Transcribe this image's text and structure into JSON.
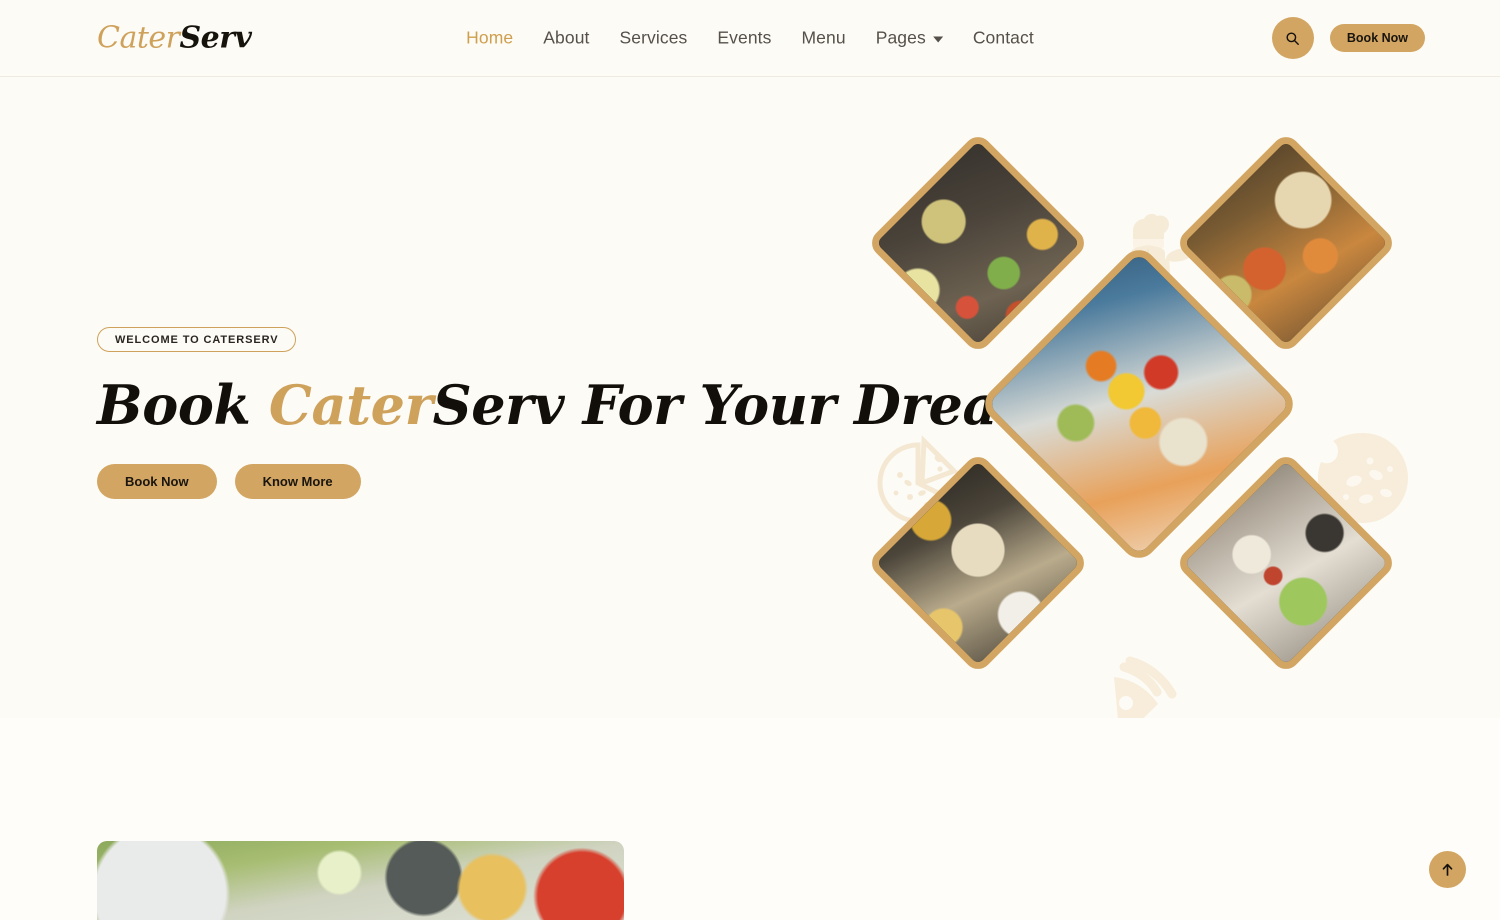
{
  "brand": {
    "logo_part_one": "Cater",
    "logo_part_two": "Serv"
  },
  "header": {
    "nav": [
      {
        "label": "Home",
        "active": true,
        "has_dropdown": false
      },
      {
        "label": "About",
        "active": false,
        "has_dropdown": false
      },
      {
        "label": "Services",
        "active": false,
        "has_dropdown": false
      },
      {
        "label": "Events",
        "active": false,
        "has_dropdown": false
      },
      {
        "label": "Menu",
        "active": false,
        "has_dropdown": false
      },
      {
        "label": "Pages",
        "active": false,
        "has_dropdown": true
      },
      {
        "label": "Contact",
        "active": false,
        "has_dropdown": false
      }
    ],
    "search_icon": "search-icon",
    "book_now_label": "Book Now"
  },
  "hero": {
    "badge": "WELCOME TO CATERSERV",
    "title_part_1": "Book ",
    "title_highlight": "Cater",
    "title_part_2": "Serv For Your Dream Event",
    "primary_button": "Book Now",
    "secondary_button": "Know More",
    "collage": [
      {
        "name": "buffet-salad-platters"
      },
      {
        "name": "roasted-appetizer-tray"
      },
      {
        "name": "floral-table-centerpiece"
      },
      {
        "name": "chafing-dish-spread"
      },
      {
        "name": "canape-buffet-table"
      }
    ],
    "decorations": [
      {
        "name": "chef-icon"
      },
      {
        "name": "pizza-slice-cut-icon"
      },
      {
        "name": "pizza-whole-icon"
      },
      {
        "name": "pizza-slice-icon"
      }
    ]
  },
  "next_section": {
    "image_name": "outdoor-garden-dining"
  },
  "controls": {
    "back_to_top": "back-to-top-icon"
  },
  "colors": {
    "accent": "#d2a662",
    "accent_text": "#cf9f4e",
    "background": "#fdfbf6",
    "text_dark": "#120f0a",
    "nav_text": "#55504a",
    "watermark": "#f6ecd9"
  }
}
